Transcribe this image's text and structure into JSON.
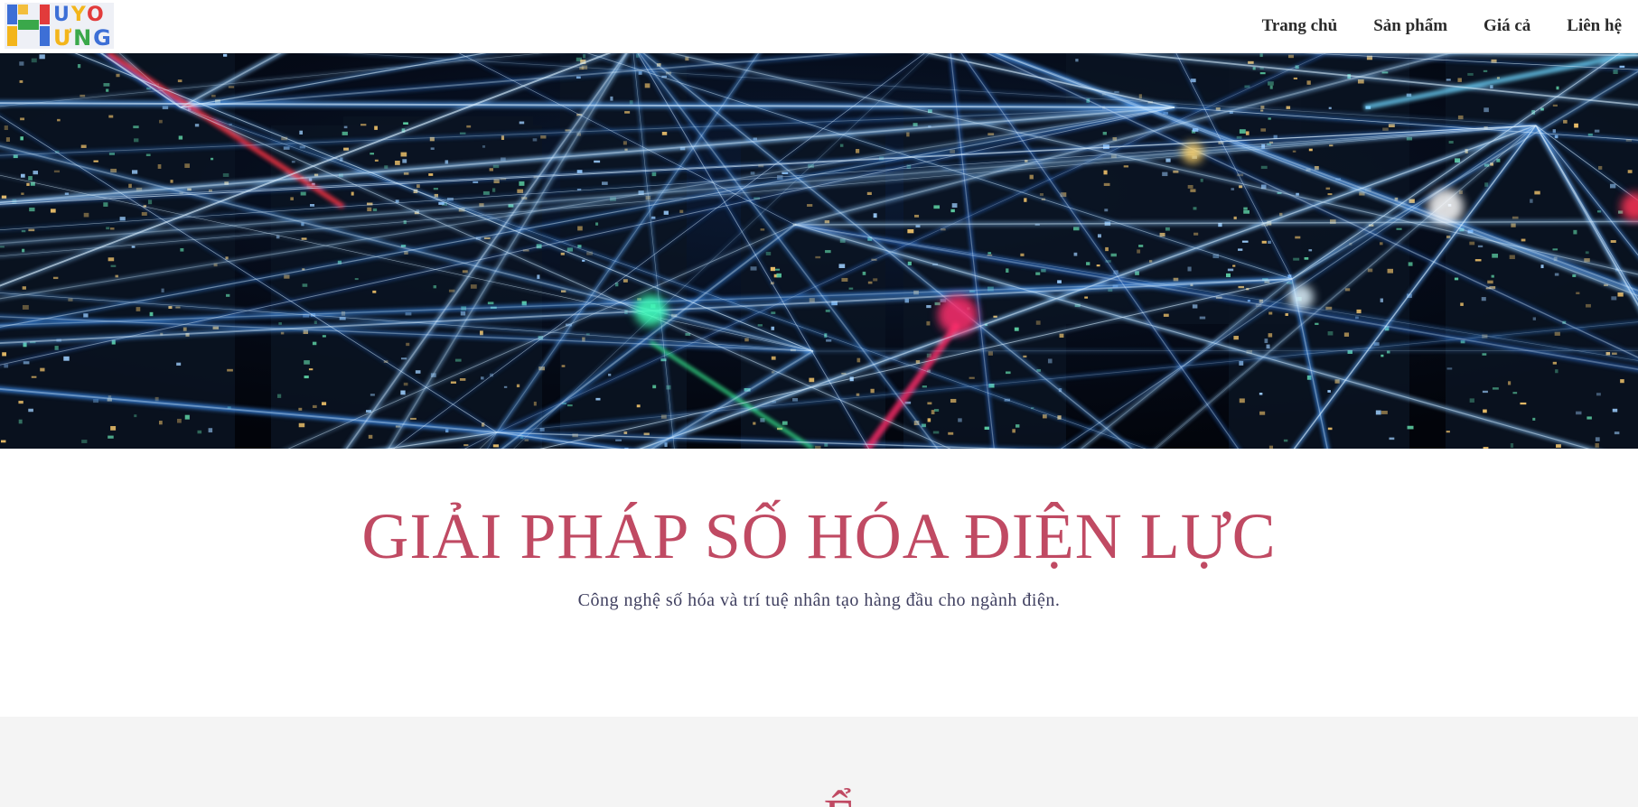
{
  "brand": {
    "logo_row1": "UYO",
    "logo_row2": "ƯNG",
    "colors": {
      "blue": "#3d6fd6",
      "red": "#e23b3b",
      "yellow": "#f3b51b",
      "green": "#3aa84a"
    }
  },
  "nav": {
    "items": [
      {
        "label": "Trang chủ"
      },
      {
        "label": "Sản phẩm"
      },
      {
        "label": "Giá cả"
      },
      {
        "label": "Liên hệ"
      }
    ]
  },
  "hero": {
    "image_icon": "city-network-lights-image"
  },
  "main": {
    "headline": "GIẢI PHÁP SỐ HÓA ĐIỆN LỰC",
    "subheadline": "Công nghệ số hóa và trí tuệ nhân tạo hàng đầu cho ngành điện.",
    "accent_color": "#c04a63"
  },
  "next_section": {
    "title_peek": "~ Ể"
  }
}
